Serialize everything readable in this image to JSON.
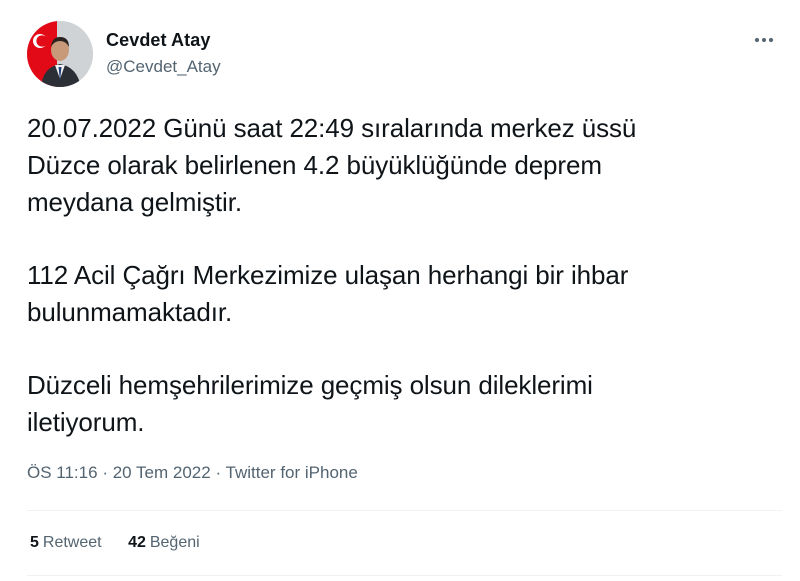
{
  "author": {
    "name": "Cevdet Atay",
    "handle": "@Cevdet_Atay"
  },
  "more_icon": "more-horizontal-icon",
  "tweet": {
    "paragraphs": [
      "20.07.2022 Günü saat 22:49 sıralarında merkez üssü\nDüzce olarak belirlenen 4.2 büyüklüğünde deprem\nmeydana gelmiştir.",
      "112 Acil Çağrı Merkezimize ulaşan herhangi bir ihbar\nbulunmamaktadır.",
      "Düzceli hemşehrilerimize geçmiş olsun dileklerimi\niletiyorum."
    ],
    "time": "ÖS 11:16",
    "separator": "·",
    "date": "20 Tem 2022",
    "source": "Twitter for iPhone"
  },
  "stats": {
    "retweets_count": "5",
    "retweets_label": "Retweet",
    "likes_count": "42",
    "likes_label": "Beğeni"
  },
  "colors": {
    "text": "#0f1419",
    "secondary": "#536471",
    "divider": "#eff3f4",
    "flag_red": "#e30a17"
  }
}
